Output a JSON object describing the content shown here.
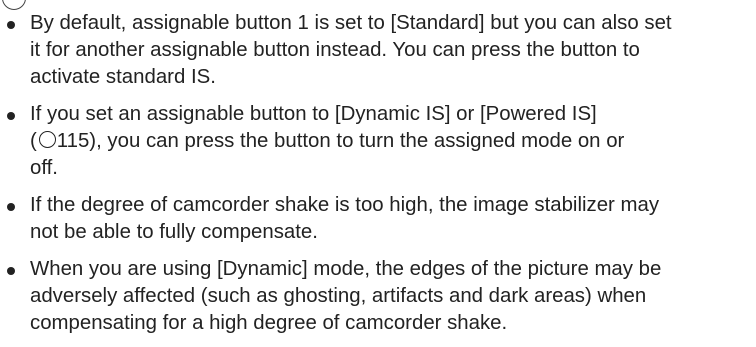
{
  "notes": [
    {
      "lines": [
        "By default, assignable button 1 is set to [Standard] but you can also set",
        "it for another assignable button instead. You can press the button to",
        "activate standard IS."
      ]
    },
    {
      "lines": [
        "If you set an assignable button to [Dynamic IS] or [Powered IS]"
      ],
      "ref": {
        "open": "(",
        "icon": "page-reference-icon",
        "page": "115), you can press the button to turn the assigned mode on or"
      },
      "tail": "off."
    },
    {
      "lines": [
        "If the degree of camcorder shake is too high, the image stabilizer may",
        "not be able to fully compensate."
      ]
    },
    {
      "lines": [
        "When you are using [Dynamic] mode, the edges of the picture may be",
        "adversely affected (such as ghosting, artifacts and dark areas) when",
        "compensating for a high degree of camcorder shake."
      ]
    }
  ]
}
